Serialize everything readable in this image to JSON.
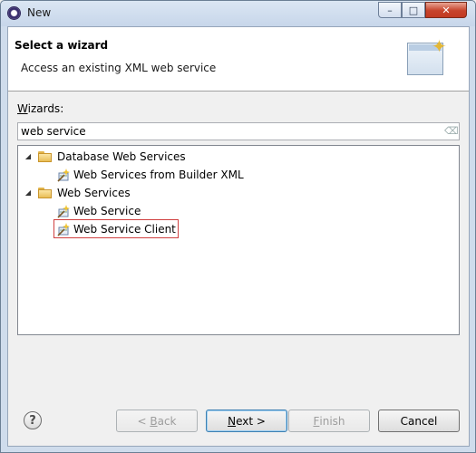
{
  "window": {
    "title": "New",
    "buttons": {
      "minimize": "–",
      "maximize": "□",
      "close": "✕"
    }
  },
  "header": {
    "title": "Select a wizard",
    "description": "Access an existing XML web service"
  },
  "wizards": {
    "label_prefix": "W",
    "label_rest": "izards:",
    "filter_value": "web service",
    "tree": [
      {
        "label": "Database Web Services",
        "expanded": true,
        "children": [
          {
            "label": "Web Services from Builder XML"
          }
        ]
      },
      {
        "label": "Web Services",
        "expanded": true,
        "children": [
          {
            "label": "Web Service"
          },
          {
            "label": "Web Service Client",
            "selected": true
          }
        ]
      }
    ]
  },
  "footer": {
    "help": "?",
    "back": {
      "pre": "< ",
      "mn": "B",
      "post": "ack",
      "enabled": false
    },
    "next": {
      "pre": "",
      "mn": "N",
      "post": "ext >",
      "enabled": true
    },
    "finish": {
      "pre": "",
      "mn": "F",
      "post": "inish",
      "enabled": false
    },
    "cancel": {
      "label": "Cancel",
      "enabled": true
    }
  },
  "colors": {
    "selection_outline": "#d04040",
    "titlebar": "#dbe6f3"
  },
  "icons": {
    "app": "eclipse-icon",
    "folder": "folder-icon",
    "web_service": "web-service-wizard-icon",
    "banner": "wizard-banner-icon",
    "help": "help-icon"
  }
}
